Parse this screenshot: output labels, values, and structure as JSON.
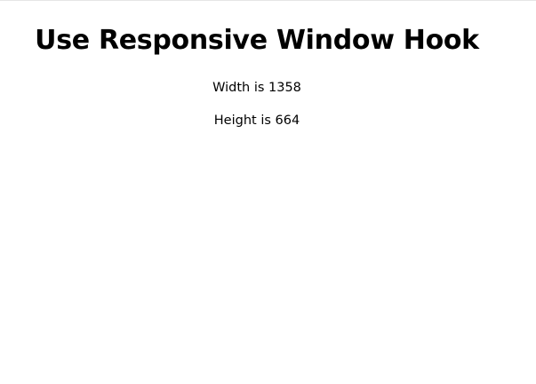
{
  "page": {
    "title": "Use Responsive Window Hook"
  },
  "metrics": {
    "width_text": "Width is 1358",
    "height_text": "Height is 664"
  }
}
